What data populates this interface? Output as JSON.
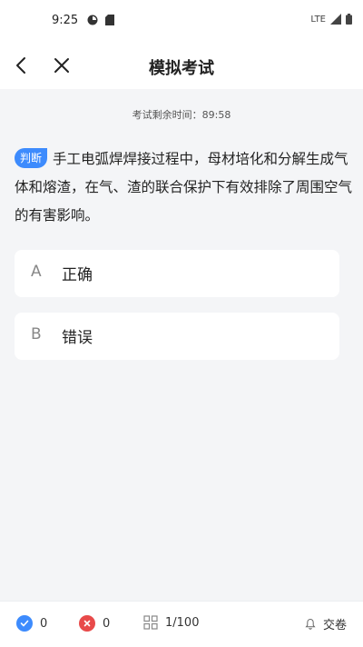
{
  "status_bar": {
    "time": "9:25",
    "network": "LTE"
  },
  "nav": {
    "title": "模拟考试"
  },
  "timer": {
    "text": "考试剩余时间：89:58"
  },
  "question": {
    "type_badge": "判断",
    "text": "手工电弧焊焊接过程中，母材培化和分解生成气体和熔渣，在气、渣的联合保护下有效排除了周围空气的有害影响。"
  },
  "options": [
    {
      "letter": "A",
      "text": "正确"
    },
    {
      "letter": "B",
      "text": "错误"
    }
  ],
  "bottom_bar": {
    "correct_count": "0",
    "wrong_count": "0",
    "progress": "1/100",
    "submit_label": "交卷"
  },
  "colors": {
    "accent": "#3d8bfd",
    "wrong": "#e84a4a",
    "background": "#f4f5f7"
  }
}
